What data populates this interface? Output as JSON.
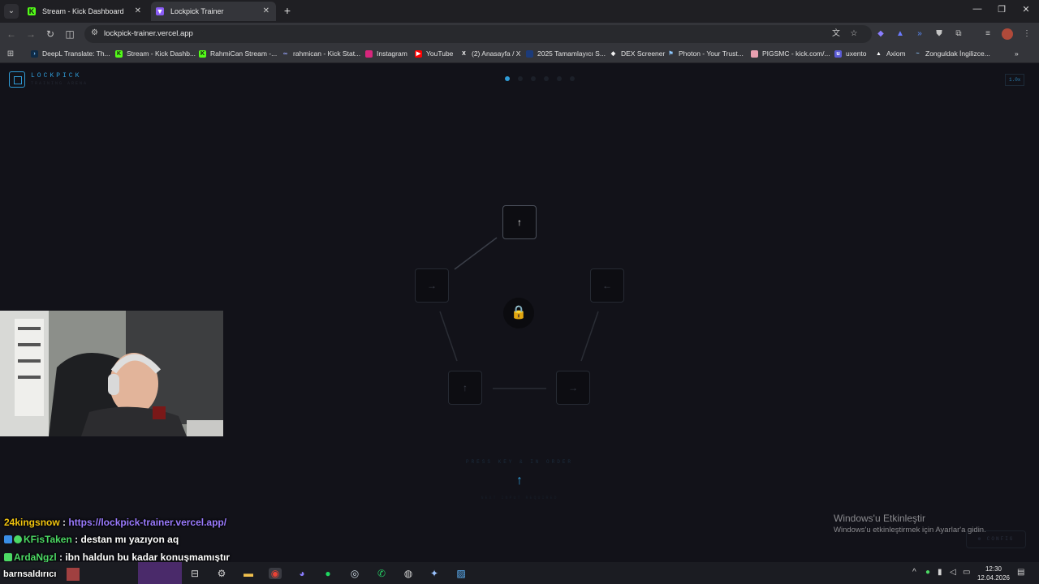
{
  "browser": {
    "tabs": [
      {
        "label": "Stream - Kick Dashboard",
        "active": false
      },
      {
        "label": "Lockpick Trainer",
        "active": true
      }
    ],
    "url": "lockpick-trainer.vercel.app",
    "bookmarks": [
      "DeepL Translate: Th...",
      "Stream - Kick Dashb...",
      "RahmiCan Stream -...",
      "rahmican - Kick Stat...",
      "Instagram",
      "YouTube",
      "(2) Anasayfa / X",
      "2025 Tamamlayıcı S...",
      "DEX Screener",
      "Photon - Your Trust...",
      "PIGSMC - kick.com/...",
      "uxento",
      "Axiom",
      "Zonguldak İngilizce..."
    ]
  },
  "app": {
    "title": "LOCKPICK",
    "subtitle": "TRAINING ARENA",
    "speed": "1.0x",
    "progress": {
      "steps": 6,
      "current": 1
    },
    "keys": {
      "top": "↑",
      "left": "→",
      "right": "←",
      "bottom_left": "↑",
      "bottom_right": "→"
    },
    "lock_icon": "🔒",
    "hint": "PRESS KEY & IN ORDER",
    "next_key": "↑",
    "hint_sub": "NEXT INPUT REQUIRED",
    "config_label": "⚙ CONFIG"
  },
  "chat": [
    {
      "user": "24kingsnow",
      "sep": " : ",
      "text": "https://lockpick-trainer.vercel.app/"
    },
    {
      "user": "KFisTaken",
      "sep": " : ",
      "text": "destan mı yazıyon aq"
    },
    {
      "user": "ArdaNgzl",
      "sep": " : ",
      "text": "ibn haldun bu kadar konuşmamıştır"
    }
  ],
  "overlay_name": "barnsaldırıcı",
  "windows_activation": {
    "title": "Windows'u Etkinleştir",
    "subtitle": "Windows'u etkinleştirmek için Ayarlar'a gidin."
  },
  "clock": {
    "time": "12:30",
    "date": "12.04.2026"
  },
  "colors": {
    "accent": "#2f9bd6",
    "background": "#121219",
    "lock": "#f5c518"
  }
}
